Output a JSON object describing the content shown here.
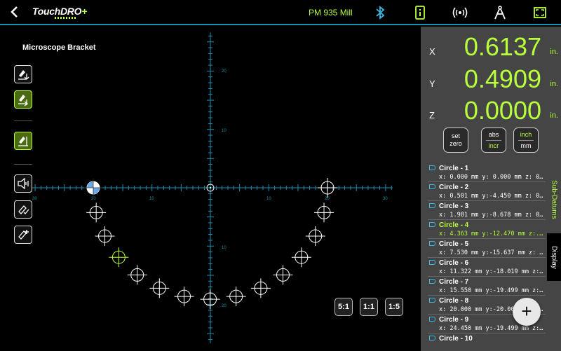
{
  "app": {
    "logo_main": "TouchDRO",
    "logo_plus": "+",
    "machine_name": "PM 935 Mill"
  },
  "toolbar": {
    "icons": [
      "back-icon",
      "bluetooth-icon",
      "info-icon",
      "wireless-icon",
      "compass-icon",
      "fullscreen-icon"
    ]
  },
  "job": {
    "title": "Microscope Bracket"
  },
  "axes": [
    {
      "label": "X",
      "value": "0.6137",
      "unit": "in."
    },
    {
      "label": "Y",
      "value": "0.4909",
      "unit": "in."
    },
    {
      "label": "Z",
      "value": "0.0000",
      "unit": "in."
    }
  ],
  "buttons": {
    "set_zero_1": "set",
    "set_zero_2": "zero",
    "abs": "abs",
    "incr": "incr",
    "inch": "inch",
    "mm": "mm"
  },
  "zoom": [
    "5:1",
    "1:1",
    "1:5"
  ],
  "tabs": {
    "sub_datums": "Sub-Datums",
    "display": "Display"
  },
  "fab": "+",
  "grid_labels": {
    "y_top": "20",
    "y_mid": "10",
    "y_low": "10",
    "y_bot": "20",
    "x_l30": "30",
    "x_l20": "20",
    "x_l10": "10",
    "x_r10": "10",
    "x_r20": "20",
    "x_r30": "30"
  },
  "colors": {
    "accent_green": "#b8ff3c",
    "axis_blue": "#1d8fb3",
    "panel_gray": "#454545"
  },
  "datums": [
    {
      "name": "Circle - 1",
      "coords": "x: 0.000 mm y: 0.000 mm z: 0..."
    },
    {
      "name": "Circle - 2",
      "coords": "x: 0.501 mm y:-4.450 mm z: 0..."
    },
    {
      "name": "Circle - 3",
      "coords": "x: 1.981 mm y:-8.678 mm z: 0..."
    },
    {
      "name": "Circle - 4",
      "coords": "x: 4.363 mm y:-12.470 mm z:..."
    },
    {
      "name": "Circle - 5",
      "coords": "x: 7.530 mm y:-15.637 mm z: ..."
    },
    {
      "name": "Circle - 6",
      "coords": "x: 11.322 mm y:-18.019 mm z:..."
    },
    {
      "name": "Circle - 7",
      "coords": "x: 15.550 mm y:-19.499 mm z:..."
    },
    {
      "name": "Circle - 8",
      "coords": "x: 20.000 mm y:-20.000 mm z:..."
    },
    {
      "name": "Circle - 9",
      "coords": "x: 24.450 mm y:-19.499 mm z:..."
    },
    {
      "name": "Circle - 10",
      "coords": ""
    }
  ]
}
